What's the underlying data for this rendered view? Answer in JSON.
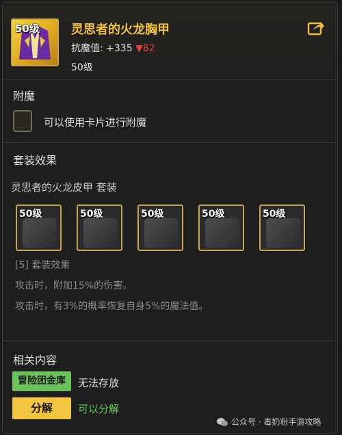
{
  "item": {
    "level_badge": "50级",
    "name": "灵思者的火龙胸甲",
    "stat_label": "抗魔值:",
    "stat_value": "+335",
    "stat_down_arrow": "▼",
    "stat_down_value": "82",
    "level_text": "50级"
  },
  "enchant": {
    "section_title": "附魔",
    "hint": "可以使用卡片进行附魔"
  },
  "set": {
    "section_title": "套装效果",
    "set_name": "灵思者的火龙皮甲  套装",
    "pieces": [
      {
        "level": "50级",
        "icon": "helmet-icon"
      },
      {
        "level": "50级",
        "icon": "pants-icon"
      },
      {
        "level": "50级",
        "icon": "shoulder-icon"
      },
      {
        "level": "50级",
        "icon": "belt-icon"
      },
      {
        "level": "50级",
        "icon": "boots-icon"
      }
    ],
    "effect_header": "[5] 套装效果",
    "effect_lines": [
      "攻击时，附加15%的伤害。",
      "攻击时，有3%的概率恢复自身5%的魔法值。"
    ]
  },
  "related": {
    "section_title": "相关内容",
    "storage_tag": "冒险团金库",
    "storage_value": "无法存放",
    "decompose_tag": "分解",
    "decompose_value": "可以分解"
  },
  "watermark": {
    "text": "公众号 · 毒奶粉手游攻略"
  },
  "colors": {
    "title_gold": "#f0c040",
    "stat_down_red": "#e04040",
    "tag_green": "#6cc25a",
    "tag_yellow": "#f2c440",
    "decompose_green": "#5ad04a",
    "frame_gold": "#c9a44a"
  }
}
